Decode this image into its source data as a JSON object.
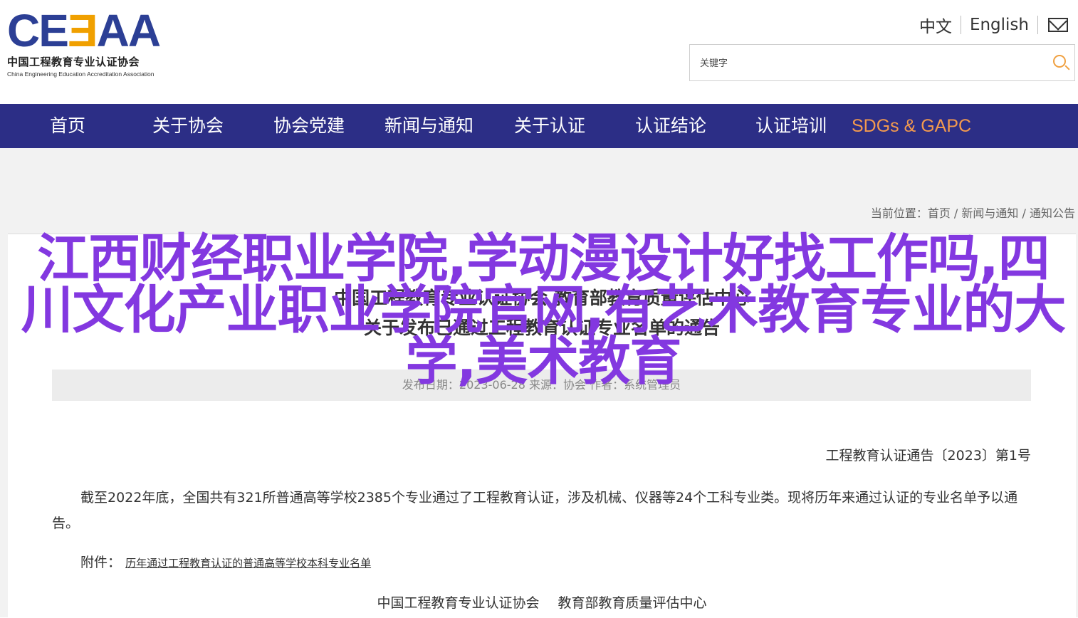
{
  "header": {
    "logo": {
      "mark_part1": "CE",
      "mark_part2": "Ǝ",
      "mark_part3": "AA",
      "cn_name": "中国工程教育专业认证协会",
      "en_name": "China Engineering Education Accreditation Association"
    },
    "lang_cn": "中文",
    "lang_en": "English",
    "mail_icon": "mail-icon",
    "search": {
      "placeholder": "关键字",
      "icon": "search-icon"
    }
  },
  "nav": {
    "items": [
      {
        "label": "首页"
      },
      {
        "label": "关于协会"
      },
      {
        "label": "协会党建"
      },
      {
        "label": "新闻与通知"
      },
      {
        "label": "关于认证"
      },
      {
        "label": "认证结论"
      },
      {
        "label": "认证培训"
      },
      {
        "label": "SDGs & GAPC"
      }
    ],
    "highlight_color": "#f39a4e",
    "bg_color": "#2c2e86"
  },
  "breadcrumb": {
    "prefix": "当前位置：",
    "items": [
      "首页",
      "新闻与通知",
      "通知公告"
    ],
    "sep": " / "
  },
  "article": {
    "title_line1": "中国工程教育专业认证协会 教育部教育质量评估中心",
    "title_line2": "关于发布已通过工程教育认证专业名单的通告",
    "meta": "发布日期：2023-06-28 来源：协会 作者：系统管理员",
    "notice_no": "工程教育认证通告〔2023〕第1号",
    "body": "截至2022年底，全国共有321所普通高等学校2385个专业通过了工程教育认证，涉及机械、仪器等24个工科专业类。现将历年来通过认证的专业名单予以通告。",
    "attach_label": "附件：",
    "attach_link": "历年通过工程教育认证的普通高等学校本科专业名单",
    "sign1": "中国工程教育专业认证协会",
    "sign2": "教育部教育质量评估中心"
  },
  "overlay": {
    "text": "江西财经职业学院,学动漫设计好找工作吗,四川文化产业职业学院官网,有艺术教育专业的大学,美术教育",
    "color": "#8338e0"
  }
}
